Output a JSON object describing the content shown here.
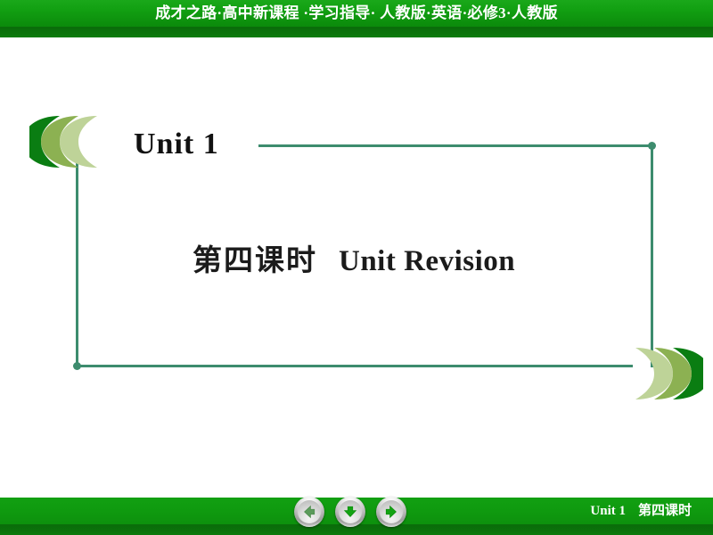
{
  "header": {
    "text": "成才之路·高中新课程 ·学习指导· 人教版·英语·必修3·人教版"
  },
  "slide": {
    "unit_label": "Unit 1",
    "lesson_cn": "第四课时",
    "lesson_en": "Unit Revision"
  },
  "footer": {
    "unit_label": "Unit 1",
    "lesson_label": "第四课时",
    "nav": {
      "prev_icon": "arrow-left-icon",
      "down_icon": "arrow-down-icon",
      "next_icon": "arrow-right-icon"
    }
  },
  "colors": {
    "header_green_light": "#1aa81a",
    "header_green_dark": "#0a6b0a",
    "frame_teal": "#3d8c6e",
    "chevron_dark": "#0a7d12",
    "chevron_mid": "#8cb152",
    "chevron_light": "#bed398",
    "nav_arrow_green": "#13a313",
    "nav_arrow_green_muted": "#5c9b5c",
    "text_white": "#ffffff",
    "text_black": "#111111"
  }
}
